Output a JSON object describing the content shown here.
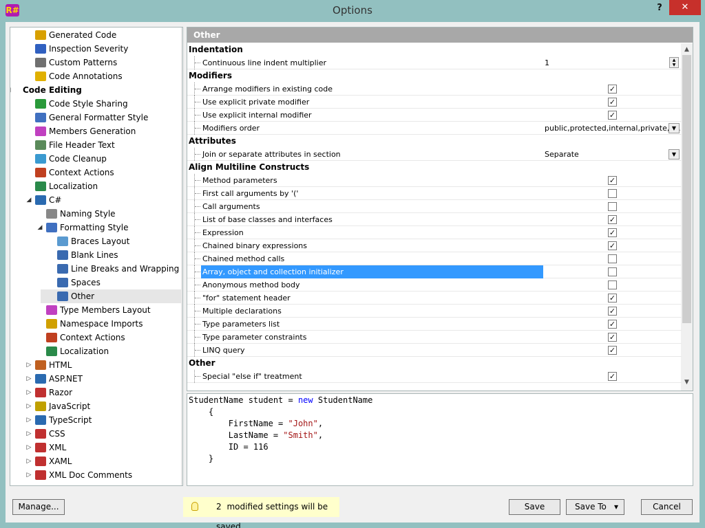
{
  "window": {
    "title": "Options",
    "help_label": "?",
    "close_label": "✕",
    "app_icon_text": "R#"
  },
  "tree": {
    "items": [
      {
        "label": "Generated Code",
        "indent": 1,
        "icon": "#d8a000",
        "icon_name": "generated-code-icon"
      },
      {
        "label": "Inspection Severity",
        "indent": 1,
        "icon": "#3060c0",
        "icon_name": "inspection-severity-icon"
      },
      {
        "label": "Custom Patterns",
        "indent": 1,
        "icon": "#707070",
        "icon_name": "custom-patterns-icon"
      },
      {
        "label": "Code Annotations",
        "indent": 1,
        "icon": "#e0b000",
        "icon_name": "code-annotations-icon"
      },
      {
        "label": "Code Editing",
        "indent": 0,
        "bold": true,
        "expander": "◢"
      },
      {
        "label": "Code Style Sharing",
        "indent": 1,
        "icon": "#2a9a3a",
        "icon_name": "code-style-sharing-icon"
      },
      {
        "label": "General Formatter Style",
        "indent": 1,
        "icon": "#4070c0",
        "icon_name": "general-formatter-style-icon"
      },
      {
        "label": "Members Generation",
        "indent": 1,
        "icon": "#c040c0",
        "icon_name": "members-generation-icon"
      },
      {
        "label": "File Header Text",
        "indent": 1,
        "icon": "#5a8a5a",
        "icon_name": "file-header-text-icon"
      },
      {
        "label": "Code Cleanup",
        "indent": 1,
        "icon": "#3a9ad0",
        "icon_name": "code-cleanup-icon"
      },
      {
        "label": "Context Actions",
        "indent": 1,
        "icon": "#c04020",
        "icon_name": "context-actions-icon"
      },
      {
        "label": "Localization",
        "indent": 1,
        "icon": "#2a8a4a",
        "icon_name": "localization-icon"
      },
      {
        "label": "C#",
        "indent": 1,
        "icon": "#2a6ab0",
        "icon_name": "csharp-icon",
        "expander": "◢"
      },
      {
        "label": "Naming Style",
        "indent": 2,
        "icon": "#888888",
        "icon_name": "naming-style-icon"
      },
      {
        "label": "Formatting Style",
        "indent": 2,
        "icon": "#4070c0",
        "icon_name": "formatting-style-icon",
        "expander": "◢"
      },
      {
        "label": "Braces Layout",
        "indent": 3,
        "icon": "#5a9ad0",
        "icon_name": "braces-layout-icon"
      },
      {
        "label": "Blank Lines",
        "indent": 3,
        "icon": "#3a6ab0",
        "icon_name": "blank-lines-icon"
      },
      {
        "label": "Line Breaks and Wrapping",
        "indent": 3,
        "icon": "#3a6ab0",
        "icon_name": "line-breaks-icon"
      },
      {
        "label": "Spaces",
        "indent": 3,
        "icon": "#3a6ab0",
        "icon_name": "spaces-icon"
      },
      {
        "label": "Other",
        "indent": 3,
        "icon": "#3a6ab0",
        "icon_name": "other-icon",
        "selected": true
      },
      {
        "label": "Type Members Layout",
        "indent": 2,
        "icon": "#c040c0",
        "icon_name": "type-members-layout-icon"
      },
      {
        "label": "Namespace Imports",
        "indent": 2,
        "icon": "#d0a000",
        "icon_name": "namespace-imports-icon"
      },
      {
        "label": "Context Actions",
        "indent": 2,
        "icon": "#c04020",
        "icon_name": "context-actions-icon"
      },
      {
        "label": "Localization",
        "indent": 2,
        "icon": "#2a8a4a",
        "icon_name": "localization-icon"
      },
      {
        "label": "HTML",
        "indent": 1,
        "icon": "#c06020",
        "icon_name": "html-icon",
        "expander": "▷"
      },
      {
        "label": "ASP.NET",
        "indent": 1,
        "icon": "#2a6ab0",
        "icon_name": "aspnet-icon",
        "expander": "▷"
      },
      {
        "label": "Razor",
        "indent": 1,
        "icon": "#c03030",
        "icon_name": "razor-icon",
        "expander": "▷"
      },
      {
        "label": "JavaScript",
        "indent": 1,
        "icon": "#c0a000",
        "icon_name": "javascript-icon",
        "expander": "▷"
      },
      {
        "label": "TypeScript",
        "indent": 1,
        "icon": "#2a6ab0",
        "icon_name": "typescript-icon",
        "expander": "▷"
      },
      {
        "label": "CSS",
        "indent": 1,
        "icon": "#c03030",
        "icon_name": "css-icon",
        "expander": "▷"
      },
      {
        "label": "XML",
        "indent": 1,
        "icon": "#c03030",
        "icon_name": "xml-icon",
        "expander": "▷"
      },
      {
        "label": "XAML",
        "indent": 1,
        "icon": "#c03030",
        "icon_name": "xaml-icon",
        "expander": "▷"
      },
      {
        "label": "XML Doc Comments",
        "indent": 1,
        "icon": "#c03030",
        "icon_name": "xml-doc-comments-icon",
        "expander": "▷"
      }
    ]
  },
  "panel": {
    "header": "Other",
    "rows": [
      {
        "type": "group",
        "label": "Indentation"
      },
      {
        "type": "value",
        "label": "Continuous line indent multiplier",
        "value": "1",
        "control": "spin"
      },
      {
        "type": "group",
        "label": "Modifiers"
      },
      {
        "type": "check",
        "label": "Arrange modifiers in existing code",
        "checked": true
      },
      {
        "type": "check",
        "label": "Use explicit private modifier",
        "checked": true
      },
      {
        "type": "check",
        "label": "Use explicit internal modifier",
        "checked": true
      },
      {
        "type": "value",
        "label": "Modifiers order",
        "value": "public,protected,internal,private,s...",
        "control": "drop"
      },
      {
        "type": "group",
        "label": "Attributes"
      },
      {
        "type": "value",
        "label": "Join or separate attributes in section",
        "value": "Separate",
        "control": "drop"
      },
      {
        "type": "group",
        "label": "Align Multiline Constructs"
      },
      {
        "type": "check",
        "label": "Method parameters",
        "checked": true
      },
      {
        "type": "check",
        "label": "First call arguments by '('",
        "checked": false
      },
      {
        "type": "check",
        "label": "Call arguments",
        "checked": false
      },
      {
        "type": "check",
        "label": "List of base classes and interfaces",
        "checked": true
      },
      {
        "type": "check",
        "label": "Expression",
        "checked": true
      },
      {
        "type": "check",
        "label": "Chained binary expressions",
        "checked": true
      },
      {
        "type": "check",
        "label": "Chained method calls",
        "checked": false
      },
      {
        "type": "check",
        "label": "Array, object and collection initializer",
        "checked": false,
        "selected": true
      },
      {
        "type": "check",
        "label": "Anonymous method body",
        "checked": false
      },
      {
        "type": "check",
        "label": "\"for\" statement header",
        "checked": true
      },
      {
        "type": "check",
        "label": "Multiple declarations",
        "checked": true
      },
      {
        "type": "check",
        "label": "Type parameters list",
        "checked": true
      },
      {
        "type": "check",
        "label": "Type parameter constraints",
        "checked": true
      },
      {
        "type": "check",
        "label": "LINQ query",
        "checked": true
      },
      {
        "type": "group",
        "label": "Other"
      },
      {
        "type": "check",
        "label": "Special \"else if\" treatment",
        "checked": true
      }
    ]
  },
  "preview": {
    "line1_a": "StudentName student = ",
    "line1_kw": "new",
    "line1_b": " StudentName",
    "line2": "    {",
    "line3_a": "        FirstName = ",
    "line3_str": "\"John\"",
    "line3_b": ",",
    "line4_a": "        LastName = ",
    "line4_str": "\"Smith\"",
    "line4_b": ",",
    "line5": "        ID = 116",
    "line6": "    }"
  },
  "footer": {
    "manage_label": "Manage...",
    "notice_count": "2",
    "notice_text": "modified settings will be saved",
    "save_label": "Save",
    "save_to_label": "Save To",
    "save_to_arrow": "▾",
    "cancel_label": "Cancel"
  }
}
